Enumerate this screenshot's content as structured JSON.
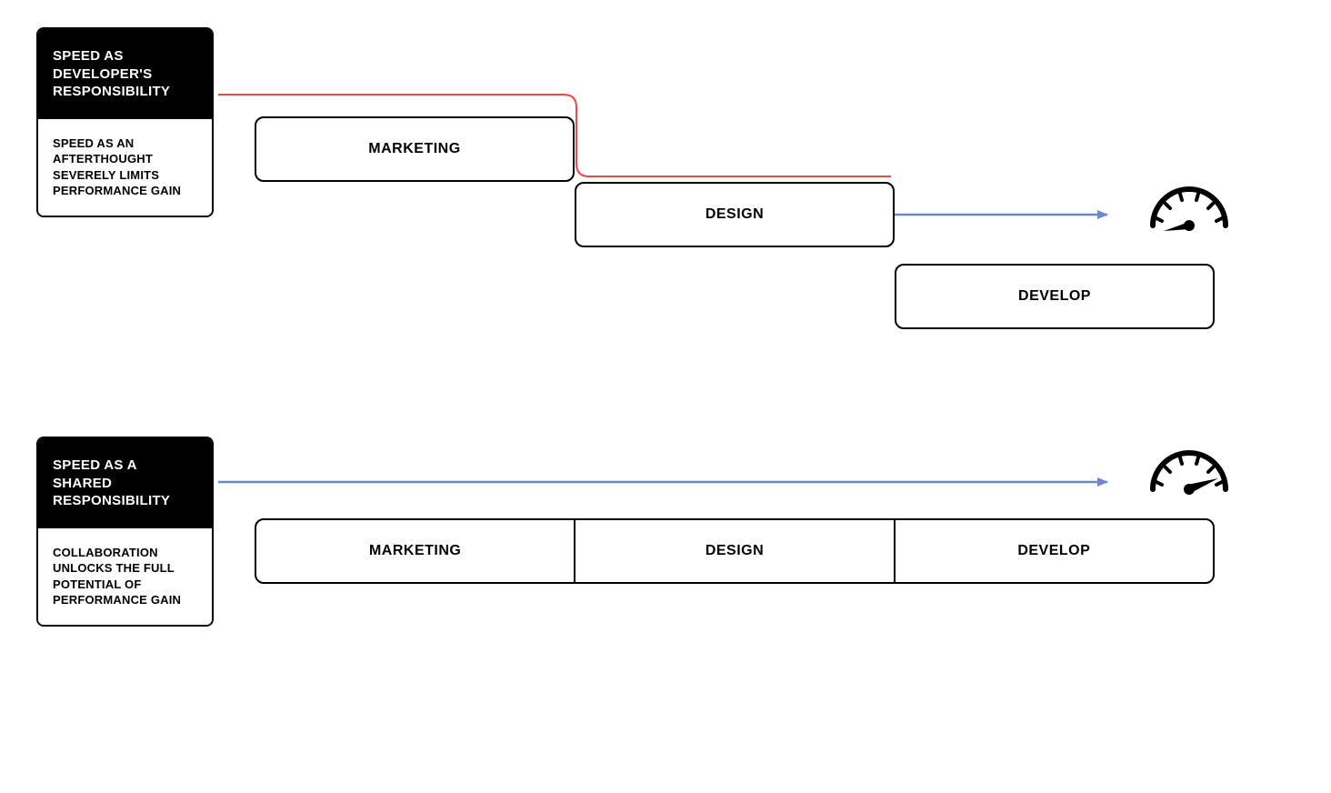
{
  "top": {
    "card": {
      "title": "SPEED AS DEVELOPER'S RESPONSIBILITY",
      "body": "SPEED AS AN AFTERTHOUGHT SEVERELY LIMITS PERFORMANCE GAIN"
    },
    "stages": {
      "marketing": "MARKETING",
      "design": "DESIGN",
      "develop": "DEVELOP"
    }
  },
  "bottom": {
    "card": {
      "title": "SPEED AS A SHARED RESPONSIBILITY",
      "body": "COLLABORATION UNLOCKS THE FULL POTENTIAL OF PERFORMANCE GAIN"
    },
    "stages": {
      "marketing": "MARKETING",
      "design": "DESIGN",
      "develop": "DEVELOP"
    }
  },
  "colors": {
    "red_line": "#e84a4a",
    "blue_arrow": "#6b88cf",
    "gauge_stroke": "#000000"
  }
}
